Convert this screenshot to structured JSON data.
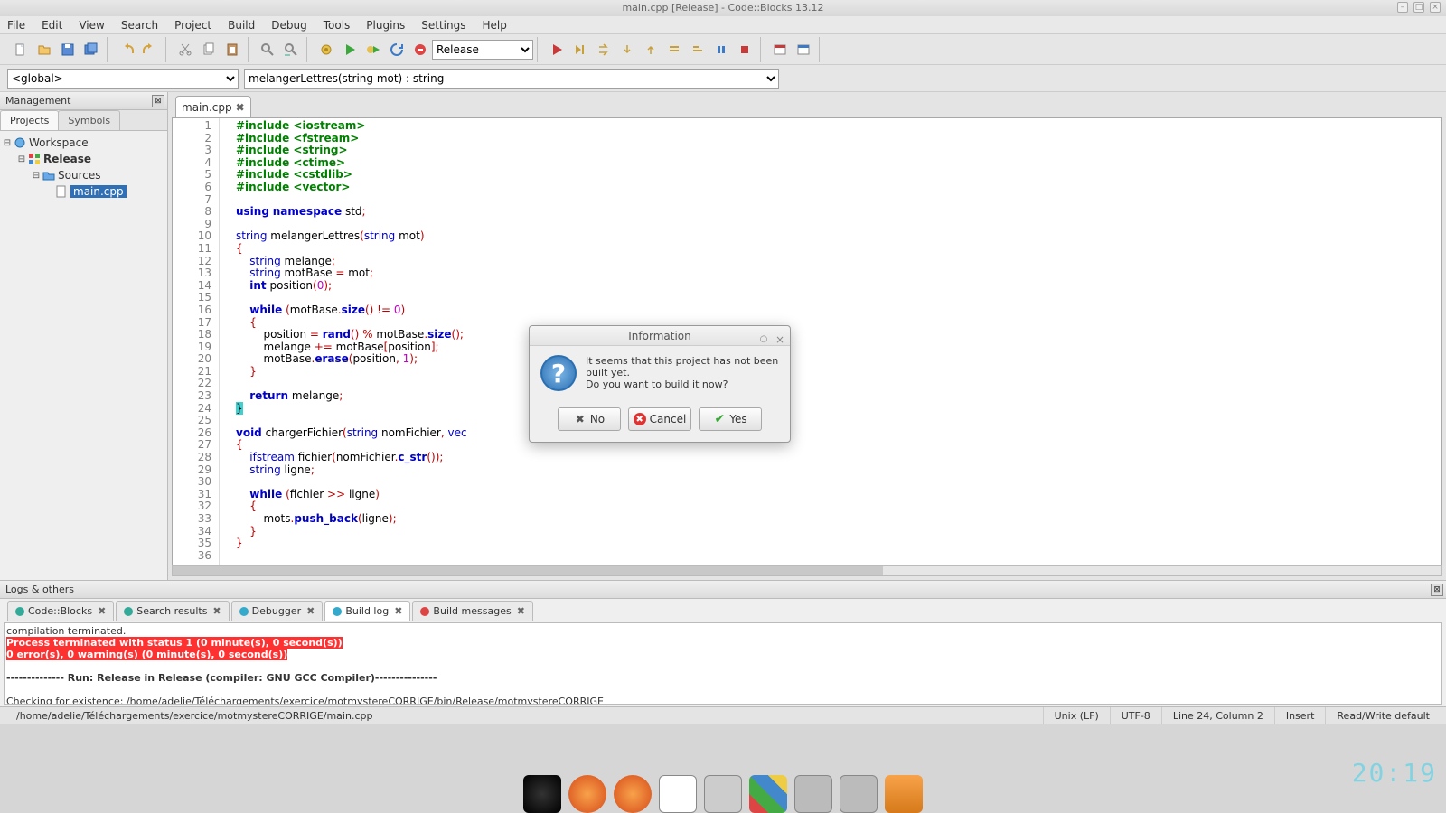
{
  "window": {
    "title": "main.cpp [Release] - Code::Blocks 13.12"
  },
  "menu": [
    "File",
    "Edit",
    "View",
    "Search",
    "Project",
    "Build",
    "Debug",
    "Tools",
    "Plugins",
    "Settings",
    "Help"
  ],
  "build_target": "Release",
  "scope": {
    "left": "<global>",
    "right": "melangerLettres(string mot) : string"
  },
  "management": {
    "title": "Management",
    "tabs": [
      "Projects",
      "Symbols"
    ],
    "tree": {
      "workspace": "Workspace",
      "project": "Release",
      "folder": "Sources",
      "file": "main.cpp"
    }
  },
  "editor": {
    "tab": "main.cpp",
    "code_lines": [
      {
        "n": 1,
        "html": "<span class='kw-green'>#include &lt;iostream&gt;</span>"
      },
      {
        "n": 2,
        "html": "<span class='kw-green'>#include &lt;fstream&gt;</span>"
      },
      {
        "n": 3,
        "html": "<span class='kw-green'>#include &lt;string&gt;</span>"
      },
      {
        "n": 4,
        "html": "<span class='kw-green'>#include &lt;ctime&gt;</span>"
      },
      {
        "n": 5,
        "html": "<span class='kw-green'>#include &lt;cstdlib&gt;</span>"
      },
      {
        "n": 6,
        "html": "<span class='kw-green'>#include &lt;vector&gt;</span>"
      },
      {
        "n": 7,
        "html": ""
      },
      {
        "n": 8,
        "html": "<span class='kw-blue'>using</span> <span class='kw-blue'>namespace</span> std<span class='punc'>;</span>"
      },
      {
        "n": 9,
        "html": ""
      },
      {
        "n": 10,
        "html": "<span class='kw-navy'>string</span> melangerLettres<span class='punc'>(</span><span class='kw-navy'>string</span> mot<span class='punc'>)</span>"
      },
      {
        "n": 11,
        "html": "<span class='punc'>{</span>"
      },
      {
        "n": 12,
        "html": "    <span class='kw-navy'>string</span> melange<span class='punc'>;</span>"
      },
      {
        "n": 13,
        "html": "    <span class='kw-navy'>string</span> motBase <span class='punc'>=</span> mot<span class='punc'>;</span>"
      },
      {
        "n": 14,
        "html": "    <span class='kw-blue'>int</span> position<span class='punc'>(</span><span class='num'>0</span><span class='punc'>);</span>"
      },
      {
        "n": 15,
        "html": ""
      },
      {
        "n": 16,
        "html": "    <span class='kw-blue'>while</span> <span class='punc'>(</span>motBase<span class='punc'>.</span><span class='hl-fn'>size</span><span class='punc'>()</span> <span class='punc'>!=</span> <span class='num'>0</span><span class='punc'>)</span>"
      },
      {
        "n": 17,
        "html": "    <span class='punc'>{</span>"
      },
      {
        "n": 18,
        "html": "        position <span class='punc'>=</span> <span class='hl-fn'>rand</span><span class='punc'>()</span> <span class='punc'>%</span> motBase<span class='punc'>.</span><span class='hl-fn'>size</span><span class='punc'>();</span>"
      },
      {
        "n": 19,
        "html": "        melange <span class='punc'>+=</span> motBase<span class='punc'>[</span>position<span class='punc'>];</span>"
      },
      {
        "n": 20,
        "html": "        motBase<span class='punc'>.</span><span class='hl-fn'>erase</span><span class='punc'>(</span>position<span class='punc'>,</span> <span class='num'>1</span><span class='punc'>);</span>"
      },
      {
        "n": 21,
        "html": "    <span class='punc'>}</span>"
      },
      {
        "n": 22,
        "html": ""
      },
      {
        "n": 23,
        "html": "    <span class='kw-blue'>return</span> melange<span class='punc'>;</span>"
      },
      {
        "n": 24,
        "html": "<span class='tealbrace'>}</span>"
      },
      {
        "n": 25,
        "html": ""
      },
      {
        "n": 26,
        "html": "<span class='kw-blue'>void</span> chargerFichier<span class='punc'>(</span><span class='kw-navy'>string</span> nomFichier<span class='punc'>,</span> <span class='kw-navy'>vec</span>"
      },
      {
        "n": 27,
        "html": "<span class='punc'>{</span>"
      },
      {
        "n": 28,
        "html": "    <span class='kw-navy'>ifstream</span> fichier<span class='punc'>(</span>nomFichier<span class='punc'>.</span><span class='hl-fn'>c_str</span><span class='punc'>());</span>"
      },
      {
        "n": 29,
        "html": "    <span class='kw-navy'>string</span> ligne<span class='punc'>;</span>"
      },
      {
        "n": 30,
        "html": ""
      },
      {
        "n": 31,
        "html": "    <span class='kw-blue'>while</span> <span class='punc'>(</span>fichier <span class='punc'>&gt;&gt;</span> ligne<span class='punc'>)</span>"
      },
      {
        "n": 32,
        "html": "    <span class='punc'>{</span>"
      },
      {
        "n": 33,
        "html": "        mots<span class='punc'>.</span><span class='hl-fn'>push_back</span><span class='punc'>(</span>ligne<span class='punc'>);</span>"
      },
      {
        "n": 34,
        "html": "    <span class='punc'>}</span>"
      },
      {
        "n": 35,
        "html": "<span class='punc'>}</span>"
      },
      {
        "n": 36,
        "html": ""
      }
    ]
  },
  "logs": {
    "title": "Logs & others",
    "tabs": [
      "Code::Blocks",
      "Search results",
      "Debugger",
      "Build log",
      "Build messages"
    ],
    "active_tab": 3,
    "lines": [
      {
        "cls": "",
        "text": "compilation terminated."
      },
      {
        "cls": "red",
        "text": "Process terminated with status 1 (0 minute(s), 0 second(s))"
      },
      {
        "cls": "red",
        "text": "0 error(s), 0 warning(s) (0 minute(s), 0 second(s))"
      },
      {
        "cls": "",
        "text": " "
      },
      {
        "cls": "bold",
        "text": "-------------- Run: Release in Release (compiler: GNU GCC Compiler)---------------"
      },
      {
        "cls": "",
        "text": " "
      },
      {
        "cls": "",
        "text": "Checking for existence: /home/adelie/Téléchargements/exercice/motmystereCORRIGE/bin/Release/motmystereCORRIGE"
      }
    ]
  },
  "dialog": {
    "title": "Information",
    "message_l1": "It seems that this project has not been built yet.",
    "message_l2": "Do you want to build it now?",
    "buttons": {
      "no": "No",
      "cancel": "Cancel",
      "yes": "Yes"
    }
  },
  "status": {
    "path": "/home/adelie/Téléchargements/exercice/motmystereCORRIGE/main.cpp",
    "eol": "Unix (LF)",
    "encoding": "UTF-8",
    "pos": "Line 24, Column 2",
    "mode": "Insert",
    "rw": "Read/Write  default"
  },
  "clock": "20:19"
}
